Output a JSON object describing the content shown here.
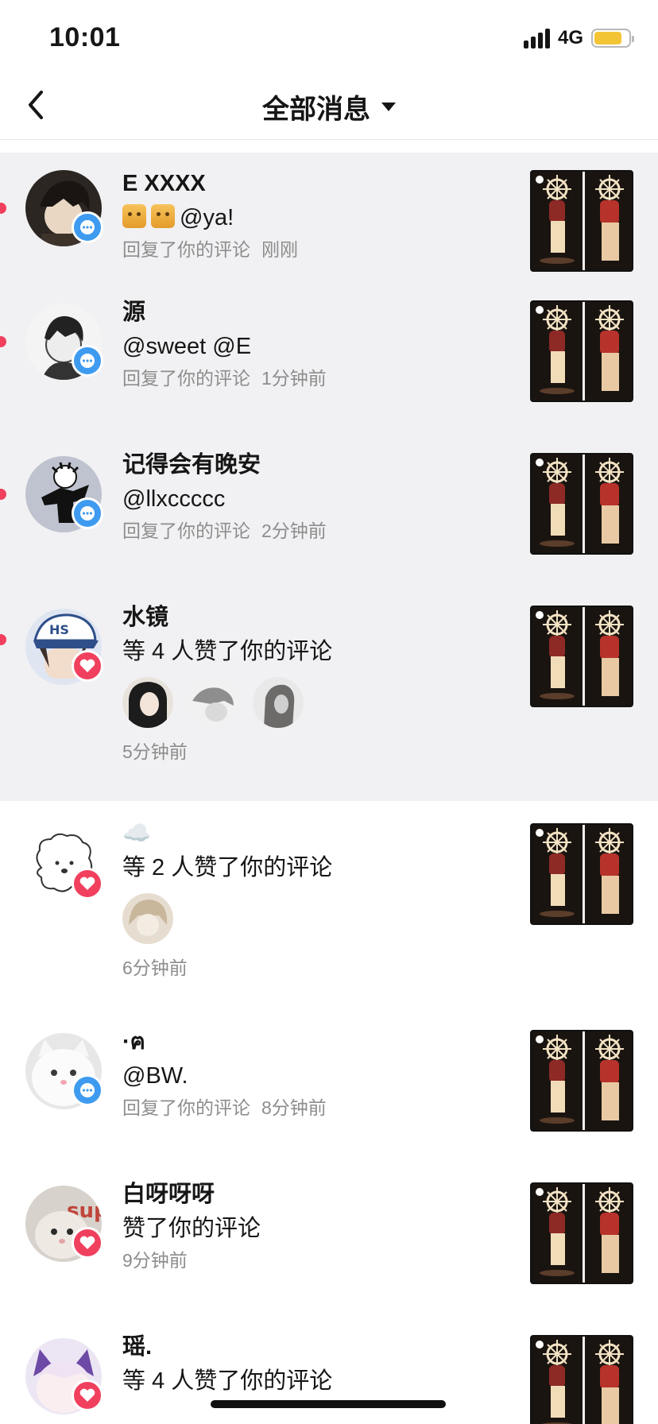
{
  "status_bar": {
    "time": "10:01",
    "network": "4G",
    "battery_percent": 80
  },
  "header": {
    "title": "全部消息",
    "back_icon": "chevron-left-icon",
    "dropdown_icon": "caret-down-icon"
  },
  "colors": {
    "unread_bg": "#f1f1f3",
    "unread_dot": "#f0405e",
    "comment_badge": "#3e9bf0",
    "like_badge": "#f0405e",
    "meta_text": "#8d8d8d"
  },
  "notifications": [
    {
      "unread": true,
      "badge": "comment",
      "name": "E XXXX",
      "message": "@ya!",
      "action": "回复了你的评论",
      "time": "刚刚"
    },
    {
      "unread": true,
      "badge": "comment",
      "name": "源",
      "message": "@sweet @E",
      "action": "回复了你的评论",
      "time": "1分钟前"
    },
    {
      "unread": true,
      "badge": "comment",
      "name": "记得会有晚安",
      "message": "@llxccccc",
      "action": "回复了你的评论",
      "time": "2分钟前"
    },
    {
      "unread": true,
      "badge": "like",
      "name": "水镜",
      "message": "等 4 人赞了你的评论",
      "liker_count": 3,
      "time": "5分钟前"
    },
    {
      "unread": false,
      "badge": "like",
      "name": "☁️",
      "message": "等 2 人赞了你的评论",
      "liker_count": 1,
      "time": "6分钟前"
    },
    {
      "unread": false,
      "badge": "comment",
      "name": "·ฅ",
      "message": "@BW.",
      "action": "回复了你的评论",
      "time": "8分钟前"
    },
    {
      "unread": false,
      "badge": "like",
      "name": "白呀呀呀",
      "message": "赞了你的评论",
      "time": "9分钟前"
    },
    {
      "unread": false,
      "badge": "like",
      "name": "瑶.",
      "message": "等 4 人赞了你的评论"
    }
  ]
}
